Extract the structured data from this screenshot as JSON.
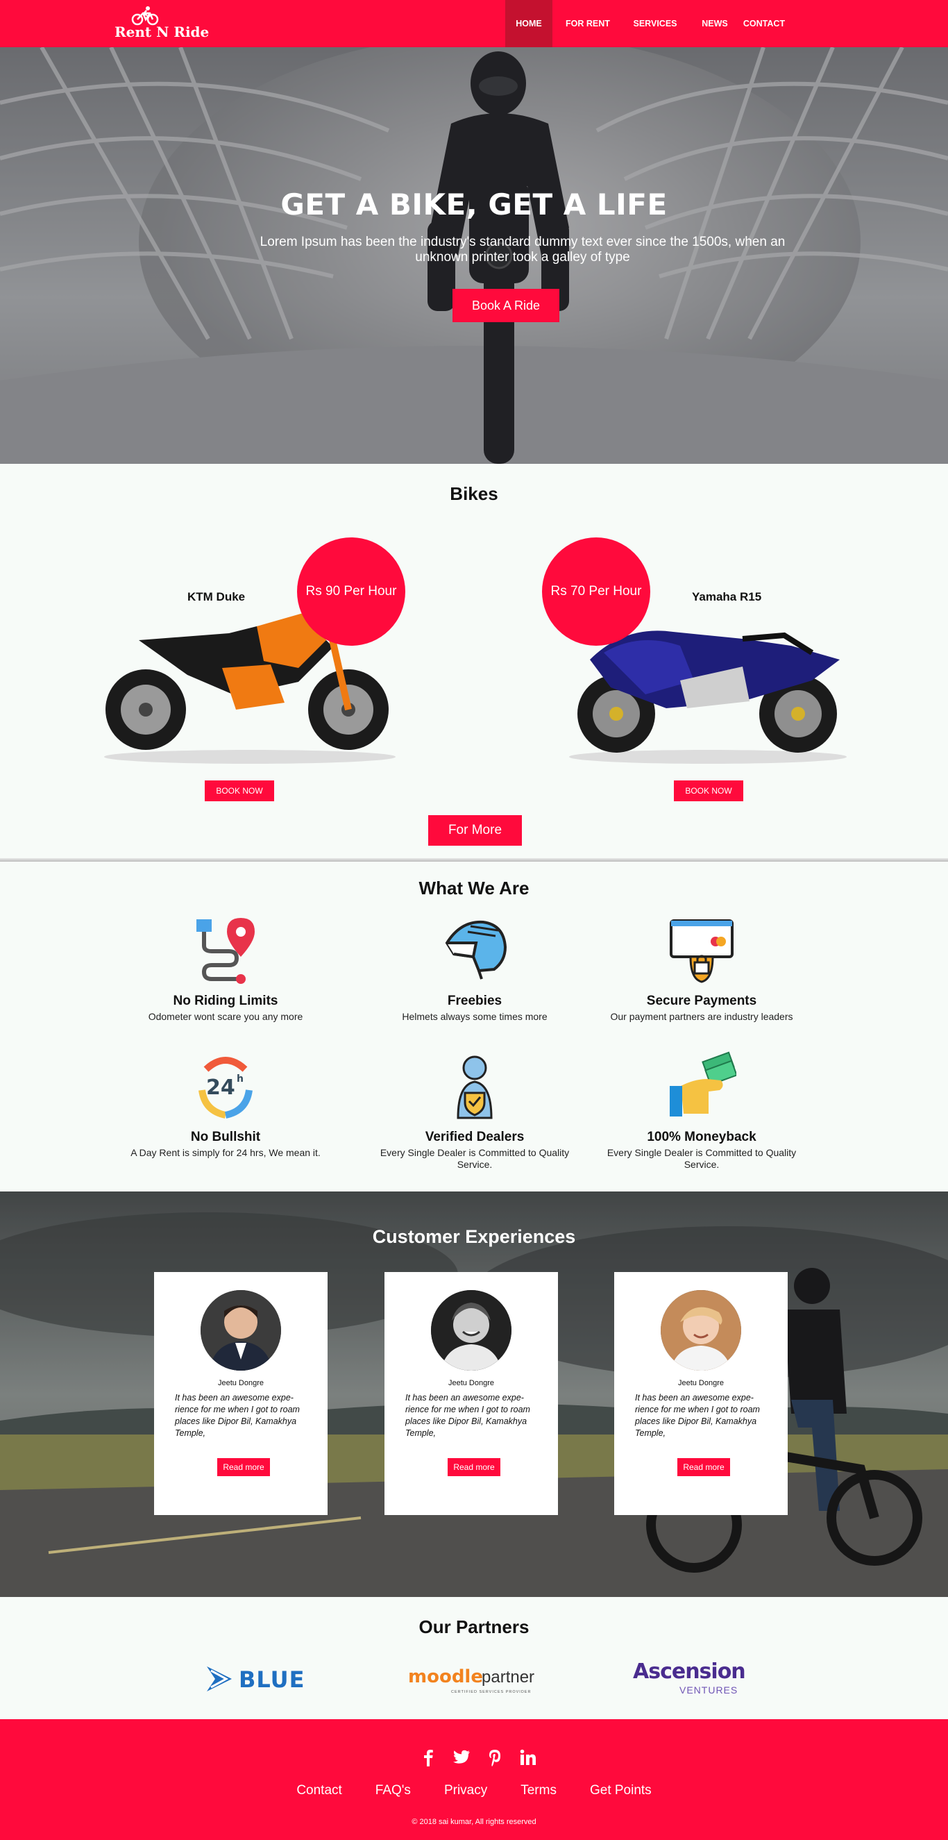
{
  "brand": {
    "name": "Rent N Ride",
    "primary_color": "#ff0a3c"
  },
  "nav": {
    "items": [
      {
        "label": "HOME",
        "active": true
      },
      {
        "label": "FOR RENT"
      },
      {
        "label": "SERVICES"
      },
      {
        "label": "NEWS"
      },
      {
        "label": "CONTACT"
      }
    ]
  },
  "hero": {
    "title": "GET A BIKE, GET A LIFE",
    "subtitle": "Lorem Ipsum has been the industry's standard dummy text ever since the 1500s, when an unknown printer took a galley of type",
    "cta": "Book A Ride"
  },
  "bikes": {
    "title": "Bikes",
    "items": [
      {
        "name": "KTM Duke",
        "price": "Rs 90 Per Hour",
        "button": "BOOK NOW"
      },
      {
        "name": "Yamaha R15",
        "price": "Rs 70 Per Hour",
        "button": "BOOK NOW"
      }
    ],
    "more": "For More"
  },
  "features": {
    "title": "What We Are",
    "items": [
      {
        "icon": "route-map-icon",
        "title": "No Riding Limits",
        "desc": "Odometer wont scare you any more"
      },
      {
        "icon": "helmet-icon",
        "title": "Freebies",
        "desc": "Helmets always some times more"
      },
      {
        "icon": "secure-payment-icon",
        "title": "Secure Payments",
        "desc": "Our payment partners are industry leaders"
      },
      {
        "icon": "24h-icon",
        "title": "No Bullshit",
        "desc": "A Day Rent is simply for 24 hrs, We mean it."
      },
      {
        "icon": "verified-dealer-icon",
        "title": "Verified Dealers",
        "desc": "Every Single Dealer is Committed to Quality Service."
      },
      {
        "icon": "moneyback-icon",
        "title": "100% Moneyback",
        "desc": "Every Single Dealer is Committed to Quality Service."
      }
    ]
  },
  "testimonials": {
    "title": "Customer Experiences",
    "items": [
      {
        "name": "Jeetu Dongre",
        "text": "It has been an awesome expe-rience for me when I got to roam places like Dipor Bil, Kamakhya Temple,",
        "button": "Read more"
      },
      {
        "name": "Jeetu Dongre",
        "text": "It has been an awesome expe-rience for me when I got to roam places like Dipor Bil, Kamakhya Temple,",
        "button": "Read more"
      },
      {
        "name": "Jeetu Dongre",
        "text": "It has been an awesome expe-rience for me when I got to roam places like Dipor Bil, Kamakhya Temple,",
        "button": "Read more"
      }
    ]
  },
  "partners": {
    "title": "Our Partners",
    "items": [
      {
        "name": "BLUE"
      },
      {
        "name": "moodle",
        "suffix": "partner",
        "tagline": "CERTIFIED SERVICES PROVIDER"
      },
      {
        "name": "Ascension",
        "suffix": "VENTURES"
      }
    ]
  },
  "footer": {
    "social": [
      "facebook-icon",
      "twitter-icon",
      "pinterest-icon",
      "linkedin-icon"
    ],
    "links": [
      "Contact",
      "FAQ's",
      "Privacy",
      "Terms",
      "Get Points"
    ],
    "copyright": "© 2018 sai kumar, All rights reserved"
  }
}
